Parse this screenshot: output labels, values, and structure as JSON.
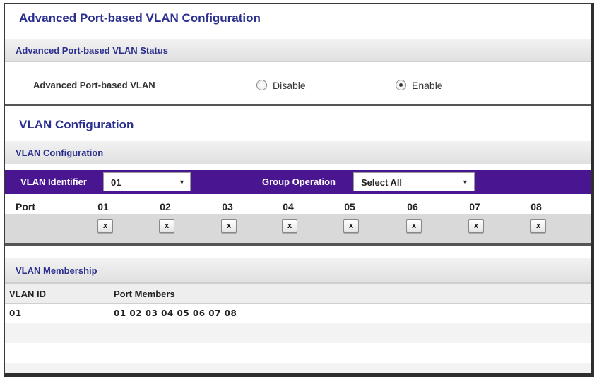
{
  "page": {
    "title": "Advanced Port-based VLAN Configuration"
  },
  "status_section": {
    "header": "Advanced Port-based VLAN Status",
    "label": "Advanced Port-based VLAN",
    "options": [
      "Disable",
      "Enable"
    ],
    "selected": "Enable"
  },
  "vlan_config": {
    "title": "VLAN Configuration",
    "header": "VLAN Configuration",
    "identifier_label": "VLAN Identifier",
    "identifier_value": "01",
    "group_operation_label": "Group Operation",
    "group_operation_value": "Select All",
    "port_label": "Port",
    "ports": [
      "01",
      "02",
      "03",
      "04",
      "05",
      "06",
      "07",
      "08"
    ],
    "port_marks": [
      "x",
      "x",
      "x",
      "x",
      "x",
      "x",
      "x",
      "x"
    ]
  },
  "membership": {
    "header": "VLAN Membership",
    "columns": [
      "VLAN ID",
      "Port Members"
    ],
    "rows": [
      {
        "vlan_id": "01",
        "members": "01 02 03 04 05 06 07 08"
      }
    ]
  },
  "colors": {
    "title_blue": "#2b2f8e",
    "bar_purple": "#4a1590",
    "band_gray": "#d9d9d9"
  }
}
